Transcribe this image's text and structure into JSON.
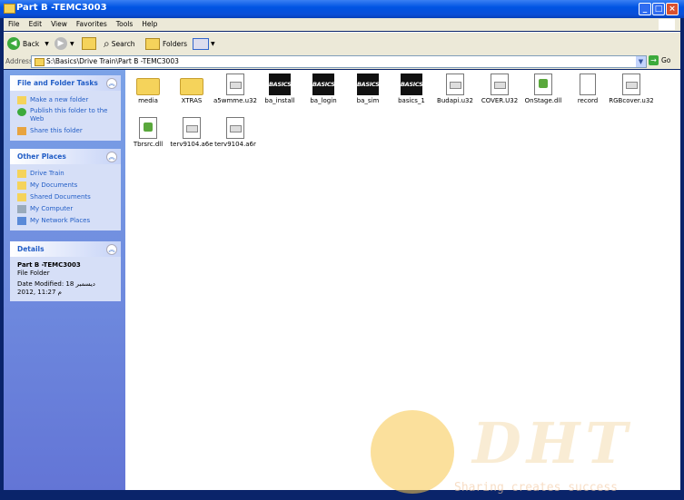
{
  "window": {
    "title": "Part B -TEMC3003"
  },
  "menu": [
    "File",
    "Edit",
    "View",
    "Favorites",
    "Tools",
    "Help"
  ],
  "toolbar": {
    "back": "Back",
    "search": "Search",
    "folders": "Folders"
  },
  "address": {
    "label": "Address",
    "path": "S:\\Basics\\Drive Train\\Part B -TEMC3003",
    "go": "Go"
  },
  "tasks": {
    "title": "File and Folder Tasks",
    "items": [
      "Make a new folder",
      "Publish this folder to the Web",
      "Share this folder"
    ]
  },
  "other_places": {
    "title": "Other Places",
    "items": [
      "Drive Train",
      "My Documents",
      "Shared Documents",
      "My Computer",
      "My Network Places"
    ]
  },
  "details": {
    "title": "Details",
    "name": "Part B -TEMC3003",
    "type": "File Folder",
    "modified_line1": "Date Modified: 18 ديسمبر",
    "modified_line2": "2012, 11:27 م"
  },
  "files": [
    {
      "name": "media",
      "icon": "folder-icon"
    },
    {
      "name": "XTRAS",
      "icon": "folder-icon"
    },
    {
      "name": "a5wmme.u32",
      "icon": "document-icon"
    },
    {
      "name": "ba_install",
      "icon": "basics-icon"
    },
    {
      "name": "ba_login",
      "icon": "basics-icon"
    },
    {
      "name": "ba_sim",
      "icon": "basics-icon"
    },
    {
      "name": "basics_1",
      "icon": "basics-icon"
    },
    {
      "name": "Budapi.u32",
      "icon": "document-icon"
    },
    {
      "name": "COVER.U32",
      "icon": "document-icon"
    },
    {
      "name": "OnStage.dll",
      "icon": "dll-icon"
    },
    {
      "name": "record",
      "icon": "notepad-icon"
    },
    {
      "name": "RGBcover.u32",
      "icon": "document-icon"
    },
    {
      "name": "Tbrsrc.dll",
      "icon": "dll-icon"
    },
    {
      "name": "terv9104.a6e",
      "icon": "document-icon"
    },
    {
      "name": "terv9104.a6r",
      "icon": "document-icon"
    }
  ],
  "watermark": {
    "brand": "DHT",
    "tagline": "Sharing creates success"
  },
  "basics_icon_text": "BASICS"
}
